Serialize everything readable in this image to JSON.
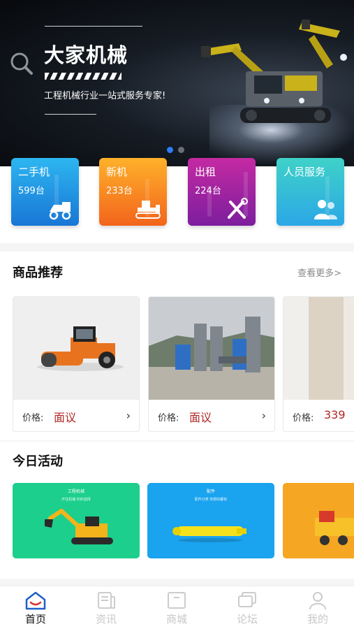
{
  "banner": {
    "title": "大家机械",
    "subtitle": "工程机械行业一站式服务专家!",
    "dots_count": 2,
    "active_dot": 0
  },
  "categories": [
    {
      "label": "二手机",
      "count": "599台",
      "icon": "roller-icon",
      "gradient": [
        "#2db6f0",
        "#1976d6"
      ]
    },
    {
      "label": "新机",
      "count": "233台",
      "icon": "dozer-icon",
      "gradient": [
        "#ffb12a",
        "#f2641c"
      ]
    },
    {
      "label": "出租",
      "count": "224台",
      "icon": "tools-icon",
      "gradient": [
        "#c42aa2",
        "#7c1e9e"
      ]
    },
    {
      "label": "人员服务",
      "count": "",
      "icon": "people-icon",
      "gradient": [
        "#3fd2c8",
        "#2ba7e6"
      ]
    }
  ],
  "products": {
    "title": "商品推荐",
    "see_more": "查看更多>",
    "items": [
      {
        "price_label": "价格:",
        "price": "面议",
        "image": "road-roller-photo"
      },
      {
        "price_label": "价格:",
        "price": "面议",
        "image": "concrete-plant-photo"
      },
      {
        "price_label": "价格:",
        "price": "339",
        "image": "stone-slab-photo"
      }
    ]
  },
  "activities": {
    "title": "今日活动",
    "items": [
      {
        "caption": "工程机械",
        "sub": "开往机械 你的选择",
        "color": "#1ccf8c"
      },
      {
        "caption": "配件",
        "sub": "配件分类 你想的都有",
        "color": "#1aa3ee"
      },
      {
        "caption": "",
        "sub": "",
        "color": "#f5a623"
      }
    ]
  },
  "tabbar": [
    {
      "label": "首页",
      "icon": "home-icon",
      "active": true
    },
    {
      "label": "资讯",
      "icon": "news-icon",
      "active": false
    },
    {
      "label": "商城",
      "icon": "shop-icon",
      "active": false
    },
    {
      "label": "论坛",
      "icon": "forum-icon",
      "active": false
    },
    {
      "label": "我的",
      "icon": "profile-icon",
      "active": false
    }
  ],
  "colors": {
    "accent": "#2f7cf6",
    "price": "#b22626",
    "tab_active": "#111111",
    "tab_inactive": "#c7c7c7"
  }
}
